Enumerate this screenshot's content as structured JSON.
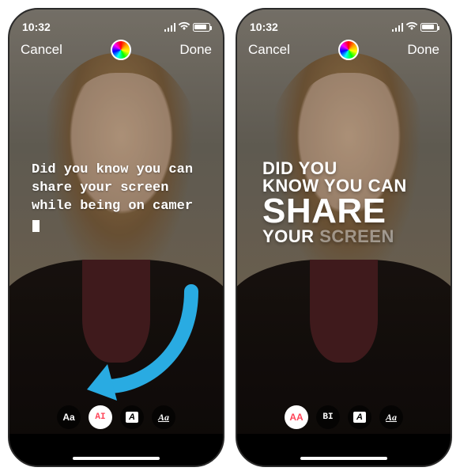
{
  "status": {
    "time": "10:32"
  },
  "topbar": {
    "cancel": "Cancel",
    "done": "Done"
  },
  "left": {
    "text": "Did you know you can share your screen while being on camer",
    "fonts": [
      "Aa",
      "AI",
      "A",
      "Aa"
    ],
    "selected_index": 1
  },
  "right": {
    "lines": {
      "l1": "DID YOU",
      "l2": "KNOW YOU CAN",
      "l3": "SHARE",
      "l4a": "YOUR",
      "l4b": "SCREEN"
    },
    "fonts": [
      "AA",
      "BI",
      "A",
      "Aa"
    ],
    "selected_index": 0
  },
  "colors": {
    "arrow": "#29abe2"
  }
}
